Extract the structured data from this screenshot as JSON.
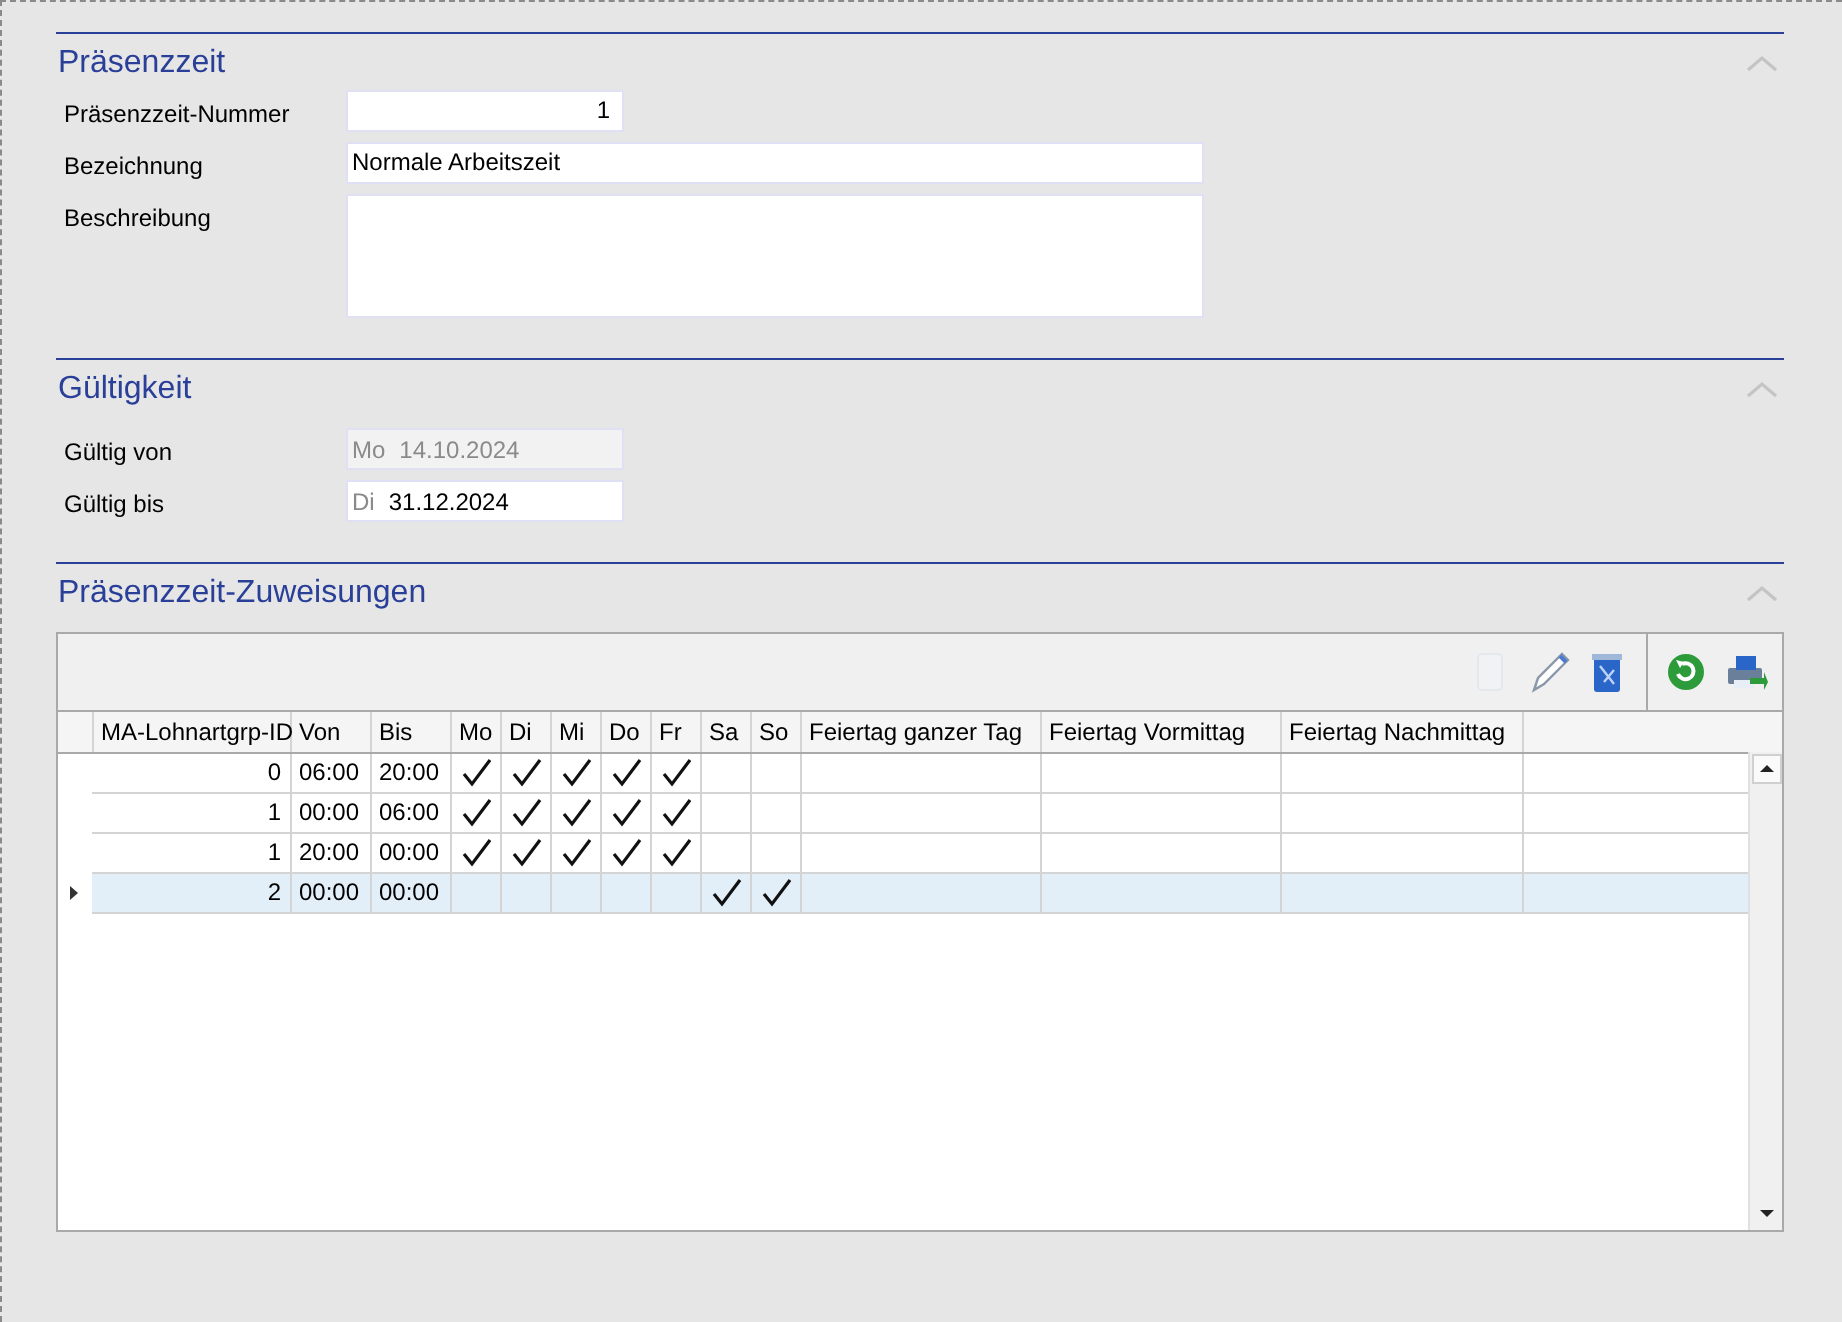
{
  "sections": [
    {
      "title": "Präsenzzeit",
      "expanded": true,
      "kind": "form",
      "fields": [
        {
          "label": "Präsenzzeit-Nummer",
          "value": "1",
          "kind": "number",
          "disabled": false
        },
        {
          "label": "Bezeichnung",
          "value": "Normale Arbeitszeit",
          "kind": "text",
          "disabled": false
        },
        {
          "label": "Beschreibung",
          "kind": "memo",
          "disabled": false
        }
      ]
    },
    {
      "title": "Gültigkeit",
      "expanded": true,
      "kind": "form",
      "fields": [
        {
          "label": "Gültig von",
          "weekday": "Mo",
          "value": "14.10.2024",
          "kind": "date",
          "disabled": true
        },
        {
          "label": "Gültig bis",
          "weekday": "Di",
          "value": "31.12.2024",
          "kind": "date",
          "disabled": false
        }
      ]
    },
    {
      "title": "Präsenzzeit-Zuweisungen",
      "expanded": true,
      "kind": "grid",
      "toolbar": [
        {
          "kind": "new",
          "disabled": true
        },
        {
          "kind": "edit",
          "disabled": false
        },
        {
          "kind": "delete",
          "disabled": false
        },
        {
          "kind": "refresh",
          "disabled": false
        },
        {
          "kind": "export",
          "disabled": false
        }
      ],
      "columns": [
        "MA-Lohnartgrp-ID",
        "Von",
        "Bis",
        "Mo",
        "Di",
        "Mi",
        "Do",
        "Fr",
        "Sa",
        "So",
        "Feiertag ganzer Tag",
        "Feiertag Vormittag",
        "Feiertag Nachmittag"
      ],
      "rows": [
        {
          "id": "0",
          "von": "06:00",
          "bis": "20:00",
          "days": [
            true,
            true,
            true,
            true,
            true,
            false,
            false
          ],
          "selected": false
        },
        {
          "id": "1",
          "von": "00:00",
          "bis": "06:00",
          "days": [
            true,
            true,
            true,
            true,
            true,
            false,
            false
          ],
          "selected": false
        },
        {
          "id": "1",
          "von": "20:00",
          "bis": "00:00",
          "days": [
            true,
            true,
            true,
            true,
            true,
            false,
            false
          ],
          "selected": false
        },
        {
          "id": "2",
          "von": "00:00",
          "bis": "00:00",
          "days": [
            false,
            false,
            false,
            false,
            false,
            true,
            true
          ],
          "selected": true
        }
      ]
    }
  ]
}
